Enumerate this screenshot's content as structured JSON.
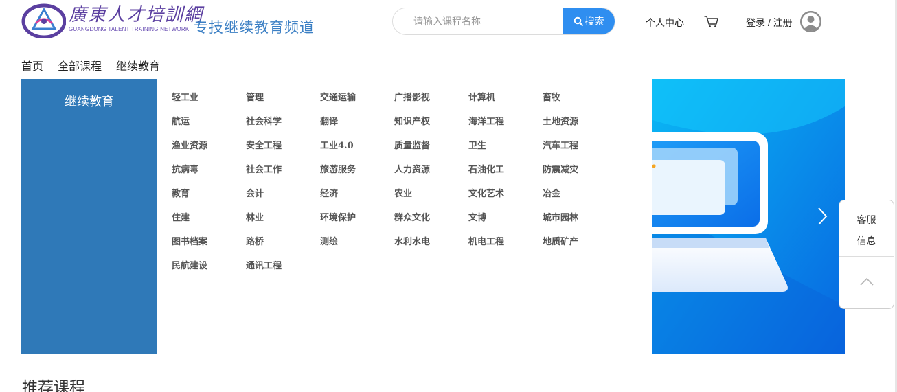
{
  "header": {
    "logo_cn": "廣東人才培訓網",
    "logo_en": "GUANGDONG TALENT TRAINING NETWORK",
    "channel_title": "专技继续教育频道",
    "search": {
      "placeholder": "请输入课程名称",
      "value": "",
      "button_label": "搜索"
    },
    "personal_center": "个人中心",
    "login_register": "登录 / 注册"
  },
  "nav": {
    "items": [
      "首页",
      "全部课程",
      "继续教育"
    ]
  },
  "category_panel": {
    "title": "继续教育",
    "items": [
      "轻工业",
      "管理",
      "交通运输",
      "广播影视",
      "计算机",
      "畜牧",
      "航运",
      "社会科学",
      "翻译",
      "知识产权",
      "海洋工程",
      "土地资源",
      "渔业资源",
      "安全工程",
      "工业4.0",
      "质量监督",
      "卫生",
      "汽车工程",
      "抗病毒",
      "社会工作",
      "旅游服务",
      "人力资源",
      "石油化工",
      "防震减灾",
      "教育",
      "会计",
      "经济",
      "农业",
      "文化艺术",
      "冶金",
      "住建",
      "林业",
      "环境保护",
      "群众文化",
      "文博",
      "城市园林",
      "图书档案",
      "路桥",
      "测绘",
      "水利水电",
      "机电工程",
      "地质矿产",
      "民航建设",
      "通讯工程"
    ]
  },
  "float_service": {
    "line1": "客服",
    "line2": "信息"
  },
  "section": {
    "title": "推荐课程"
  },
  "colors": {
    "accent": "#2f8ef0",
    "sidebar": "#2f79b8",
    "channel_title": "#3b7fc4",
    "logo": "#5b3fa0"
  },
  "icons": {
    "search": "search-icon",
    "cart": "cart-icon",
    "avatar": "user-avatar-icon",
    "banner_next": "chevron-right-icon",
    "back_to_top": "chevron-up-icon"
  }
}
